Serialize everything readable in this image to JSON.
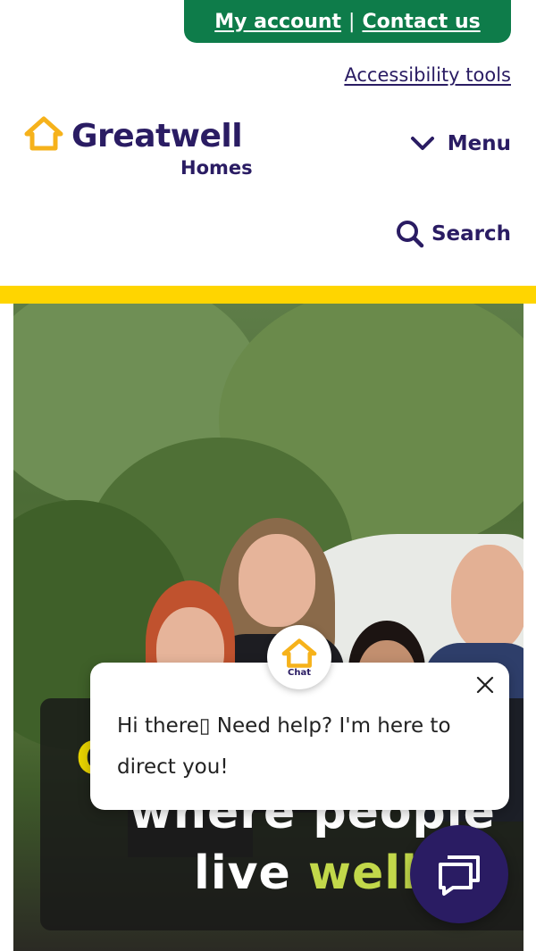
{
  "header": {
    "my_account": "My account",
    "separator": "|",
    "contact_us": "Contact us",
    "accessibility_tools": "Accessibility tools",
    "logo_word": "Greatwell",
    "logo_sub": "Homes",
    "menu_label": "Menu",
    "search_label": "Search"
  },
  "hero": {
    "partial_text": "C",
    "line1": "where people",
    "line2_prefix": "live ",
    "line2_accent": "well"
  },
  "chat": {
    "avatar_label": "Chat",
    "message": "Hi there▯ Need help? I'm here to direct you!"
  },
  "colors": {
    "brand_green": "#0e7c4a",
    "brand_navy": "#2a1c63",
    "brand_yellow": "#ffd500",
    "accent_lime": "#c2d84a"
  },
  "icons": [
    "house-logo-icon",
    "chevron-down-icon",
    "search-icon",
    "close-icon",
    "chat-icon"
  ]
}
